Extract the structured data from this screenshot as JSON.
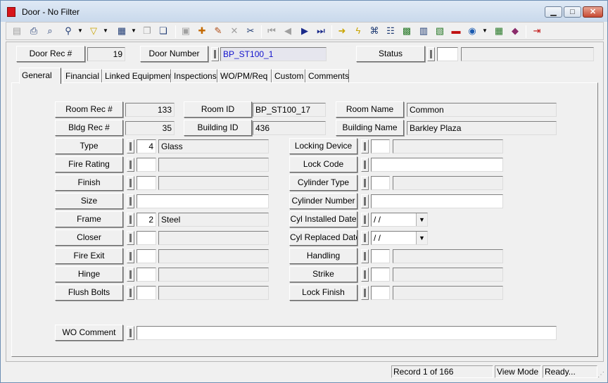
{
  "window": {
    "title": "Door - No Filter",
    "controls": {
      "minimize": "▁",
      "maximize": "□",
      "close": "✕"
    }
  },
  "toolbar": {
    "icons": [
      {
        "name": "form-view-icon",
        "glyph": "▤"
      },
      {
        "name": "print-icon",
        "glyph": "⎙"
      },
      {
        "name": "print-preview-icon",
        "glyph": "⌕"
      },
      {
        "name": "binoculars-icon",
        "glyph": "⚲"
      },
      {
        "name": "filter-icon",
        "glyph": "▽"
      },
      {
        "name": "report-icon",
        "glyph": "▦"
      },
      {
        "name": "copy-icon",
        "glyph": "❐"
      },
      {
        "name": "paste-icon",
        "glyph": "❏"
      },
      {
        "name": "save-icon",
        "glyph": "▣"
      },
      {
        "name": "new-record-icon",
        "glyph": "✚"
      },
      {
        "name": "edit-pencil-icon",
        "glyph": "✎"
      },
      {
        "name": "delete-icon",
        "glyph": "✕"
      },
      {
        "name": "cut-icon",
        "glyph": "✂"
      },
      {
        "name": "first-record-icon",
        "glyph": "⏮"
      },
      {
        "name": "previous-record-icon",
        "glyph": "◀"
      },
      {
        "name": "next-record-icon",
        "glyph": "▶"
      },
      {
        "name": "last-record-icon",
        "glyph": "⏭"
      },
      {
        "name": "goto-arrow-icon",
        "glyph": "➜"
      },
      {
        "name": "lightning-icon",
        "glyph": "ϟ"
      },
      {
        "name": "find-icon",
        "glyph": "⌘"
      },
      {
        "name": "hierarchy-icon",
        "glyph": "☷"
      },
      {
        "name": "image-icon",
        "glyph": "▩"
      },
      {
        "name": "calculator-icon",
        "glyph": "▥"
      },
      {
        "name": "map-icon",
        "glyph": "▧"
      },
      {
        "name": "car-icon",
        "glyph": "▬"
      },
      {
        "name": "globe-icon",
        "glyph": "◉"
      },
      {
        "name": "spreadsheet-icon",
        "glyph": "▦"
      },
      {
        "name": "book-icon",
        "glyph": "◆"
      },
      {
        "name": "exit-icon",
        "glyph": "⇥"
      }
    ]
  },
  "header": {
    "door_rec_label": "Door Rec #",
    "door_rec_value": "19",
    "door_number_label": "Door Number",
    "door_number_value": "BP_ST100_1",
    "status_label": "Status",
    "status_code": "",
    "status_desc": ""
  },
  "tabs": [
    "General",
    "Financial",
    "Linked Equipment",
    "Inspections",
    "WO/PM/Req",
    "Custom",
    "Comments"
  ],
  "location": {
    "room_rec_label": "Room Rec #",
    "room_rec_value": "133",
    "room_id_label": "Room ID",
    "room_id_value": "BP_ST100_17",
    "room_name_label": "Room Name",
    "room_name_value": "Common",
    "bldg_rec_label": "Bldg Rec #",
    "bldg_rec_value": "35",
    "building_id_label": "Building ID",
    "building_id_value": "436",
    "building_name_label": "Building Name",
    "building_name_value": "Barkley Plaza"
  },
  "left_fields": [
    {
      "label": "Type",
      "code": "4",
      "desc": "Glass"
    },
    {
      "label": "Fire Rating",
      "code": "",
      "desc": ""
    },
    {
      "label": "Finish",
      "code": "",
      "desc": ""
    },
    {
      "label": "Size",
      "code": "",
      "desc": ""
    },
    {
      "label": "Frame",
      "code": "2",
      "desc": "Steel"
    },
    {
      "label": "Closer",
      "code": "",
      "desc": ""
    },
    {
      "label": "Fire Exit",
      "code": "",
      "desc": ""
    },
    {
      "label": "Hinge",
      "code": "",
      "desc": ""
    },
    {
      "label": "Flush Bolts",
      "code": "",
      "desc": ""
    }
  ],
  "right_fields": [
    {
      "label": "Locking Device",
      "code": "",
      "desc": ""
    },
    {
      "label": "Lock Code",
      "value": ""
    },
    {
      "label": "Cylinder Type",
      "code": "",
      "desc": ""
    },
    {
      "label": "Cylinder Number",
      "value": ""
    },
    {
      "label": "Cyl Installed Date",
      "date": " /  /"
    },
    {
      "label": "Cyl Replaced Date",
      "date": " /  /"
    },
    {
      "label": "Handling",
      "code": "",
      "desc": ""
    },
    {
      "label": "Strike",
      "code": "",
      "desc": ""
    },
    {
      "label": "Lock Finish",
      "code": "",
      "desc": ""
    }
  ],
  "wo_comment": {
    "label": "WO Comment",
    "value": ""
  },
  "statusbar": {
    "record": "Record 1 of 166",
    "mode": "View Mode",
    "state": "Ready..."
  }
}
